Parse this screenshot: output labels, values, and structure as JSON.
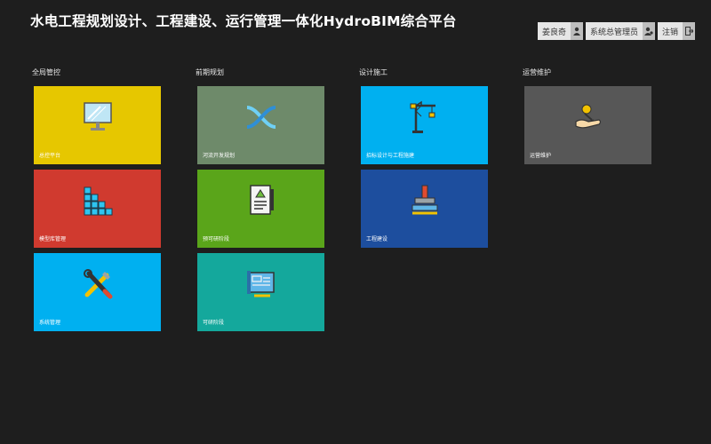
{
  "header": {
    "title": "水电工程规划设计、工程建设、运行管理一体化HydroBIM综合平台"
  },
  "topbar": {
    "user": "姜良奇",
    "role": "系统总管理员",
    "logout": "注销"
  },
  "sections": {
    "s1": "全局管控",
    "s2": "前期规划",
    "s3": "设计施工",
    "s4": "运营维护"
  },
  "tiles": {
    "t1": {
      "label": "总控平台",
      "color": "#e6c700",
      "icon": "monitor-icon"
    },
    "t2": {
      "label": "模型库管理",
      "color": "#d03a2f",
      "icon": "blocks-icon"
    },
    "t3": {
      "label": "系统管理",
      "color": "#00b0f0",
      "icon": "tools-icon"
    },
    "t4": {
      "label": "河流开发规划",
      "color": "#6e8a6a",
      "icon": "river-icon"
    },
    "t5": {
      "label": "预可研阶段",
      "color": "#5aa51a",
      "icon": "document-icon"
    },
    "t6": {
      "label": "可研阶段",
      "color": "#14a89c",
      "icon": "blueprint-icon"
    },
    "t7": {
      "label": "招标设计与工程施建",
      "color": "#00b0f0",
      "icon": "crane-icon"
    },
    "t8": {
      "label": "工程建设",
      "color": "#1d4e9e",
      "icon": "stamp-icon"
    },
    "t9": {
      "label": "运营维护",
      "color": "#575757",
      "icon": "hand-coin-icon"
    }
  }
}
